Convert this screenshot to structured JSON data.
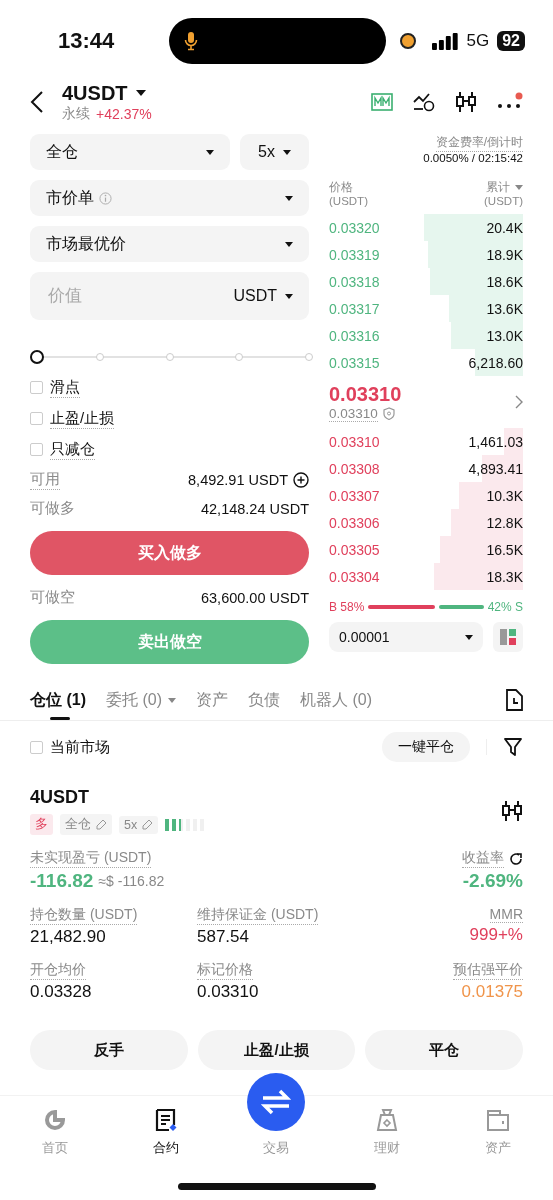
{
  "status_bar": {
    "time": "13:44",
    "network": "5G",
    "battery": "92"
  },
  "header": {
    "symbol": "4USDT",
    "type": "永续",
    "change": "+42.37%"
  },
  "order_form": {
    "margin_mode": "全仓",
    "leverage": "5x",
    "order_type": "市价单",
    "price_mode": "市场最优价",
    "amount": {
      "placeholder": "价值",
      "unit": "USDT"
    },
    "slider": {
      "level": 0
    },
    "options": [
      {
        "label": "滑点",
        "checked": false
      },
      {
        "label": "止盈/止损",
        "checked": false
      },
      {
        "label": "只减仓",
        "checked": false
      }
    ],
    "available": {
      "label": "可用",
      "value": "8,492.91 USDT"
    },
    "max_long": {
      "label": "可做多",
      "value": "42,148.24 USDT"
    },
    "buy_button": "买入做多",
    "max_short": {
      "label": "可做空",
      "value": "63,600.00 USDT"
    },
    "sell_button": "卖出做空"
  },
  "order_book": {
    "funding_label": "资金费率/倒计时",
    "funding_value": "0.0050% / 02:15:42",
    "price_header": "价格",
    "price_unit": "(USDT)",
    "total_header": "累计",
    "total_unit": "(USDT)",
    "asks": [
      {
        "price": "0.03320",
        "total": "20.4K"
      },
      {
        "price": "0.03319",
        "total": "18.9K"
      },
      {
        "price": "0.03318",
        "total": "18.6K"
      },
      {
        "price": "0.03317",
        "total": "13.6K"
      },
      {
        "price": "0.03316",
        "total": "13.0K"
      },
      {
        "price": "0.03315",
        "total": "6,218.60"
      }
    ],
    "last_price": "0.03310",
    "mark_price": "0.03310",
    "bids": [
      {
        "price": "0.03310",
        "total": "1,461.03"
      },
      {
        "price": "0.03308",
        "total": "4,893.41"
      },
      {
        "price": "0.03307",
        "total": "10.3K"
      },
      {
        "price": "0.03306",
        "total": "12.8K"
      },
      {
        "price": "0.03305",
        "total": "16.5K"
      },
      {
        "price": "0.03304",
        "total": "18.3K"
      }
    ],
    "buy_ratio": {
      "label": "B 58%",
      "level": 0.58
    },
    "sell_ratio": "42% S",
    "tick_size": "0.00001"
  },
  "tabs": [
    {
      "label": "仓位 (1)",
      "selected": true,
      "dropdown": false
    },
    {
      "label": "委托 (0)",
      "selected": false,
      "dropdown": true
    },
    {
      "label": "资产",
      "selected": false,
      "dropdown": false
    },
    {
      "label": "负债",
      "selected": false,
      "dropdown": false
    },
    {
      "label": "机器人 (0)",
      "selected": false,
      "dropdown": false
    }
  ],
  "filter": {
    "label": "当前市场",
    "checked": false,
    "close_all": "一键平仓"
  },
  "position": {
    "symbol": "4USDT",
    "side": "多",
    "margin_mode": "全仓",
    "leverage": "5x",
    "risk": {
      "level": 0.4
    },
    "metrics": [
      {
        "label": "未实现盈亏 (USDT)",
        "value": "-116.82",
        "sub": "≈$ -116.82",
        "color": "#4fb57f"
      },
      {
        "label": "收益率",
        "value": "-2.69%",
        "color": "#4fb57f"
      },
      {
        "label": "持仓数量 (USDT)",
        "value": "21,482.90",
        "color": "#111111"
      },
      {
        "label": "维持保证金 (USDT)",
        "value": "587.54",
        "color": "#111111"
      },
      {
        "label": "MMR",
        "value": "999+%",
        "color": "#e0405c"
      },
      {
        "label": "开仓均价",
        "value": "0.03328",
        "color": "#111111"
      },
      {
        "label": "标记价格",
        "value": "0.03310",
        "color": "#111111"
      },
      {
        "label": "预估强平价",
        "value": "0.01375",
        "color": "#f0944a"
      }
    ],
    "actions": [
      "反手",
      "止盈/止损",
      "平仓"
    ]
  },
  "bottom_nav": [
    {
      "label": "首页",
      "selected": false
    },
    {
      "label": "合约",
      "selected": true
    },
    {
      "label": "交易",
      "selected": false
    },
    {
      "label": "理财",
      "selected": false
    },
    {
      "label": "资产",
      "selected": false
    }
  ]
}
